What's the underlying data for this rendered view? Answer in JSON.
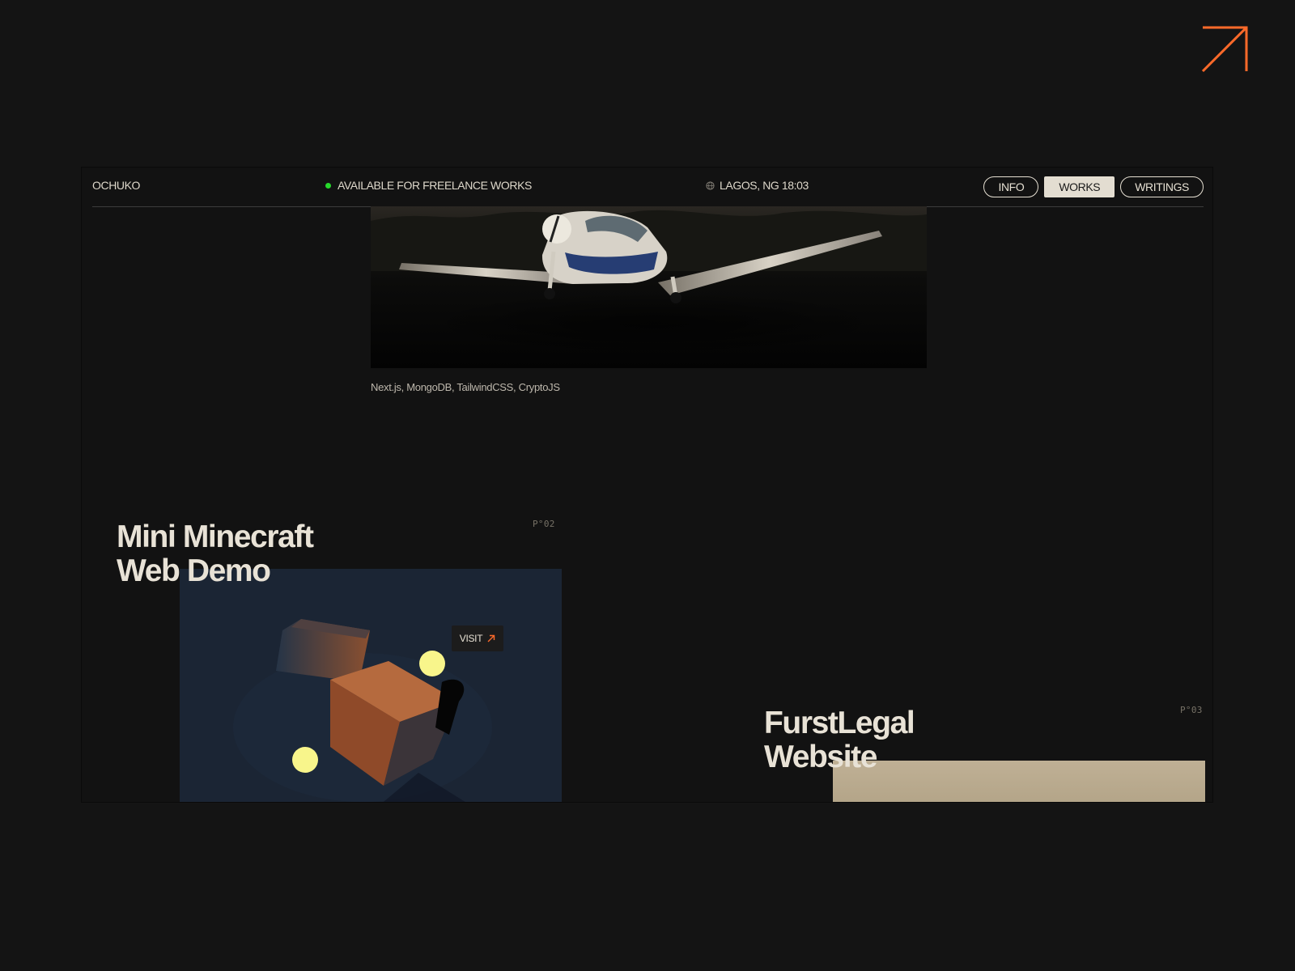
{
  "colors": {
    "background": "#141414",
    "accent": "#ff6a2a",
    "text": "#e8e2d6",
    "available_dot": "#26d92b"
  },
  "corner": {
    "icon": "arrow-up-right-icon"
  },
  "header": {
    "brand": "OCHUKO",
    "availability": "AVAILABLE FOR FREELANCE WORKS",
    "location": "LAGOS, NG 18:03",
    "location_icon": "globe-icon",
    "nav": [
      {
        "label": "INFO",
        "active": false
      },
      {
        "label": "WORKS",
        "active": true
      },
      {
        "label": "WRITINGS",
        "active": false
      }
    ]
  },
  "projects": [
    {
      "stack": "Next.js, MongoDB, TailwindCSS, CryptoJS",
      "image": "airplane"
    },
    {
      "number": "P°02",
      "title_line1": "Mini Minecraft",
      "title_line2": "Web Demo",
      "visit_label": "VISIT"
    },
    {
      "number": "P°03",
      "title_line1": "FurstLegal",
      "title_line2": "Website"
    }
  ]
}
